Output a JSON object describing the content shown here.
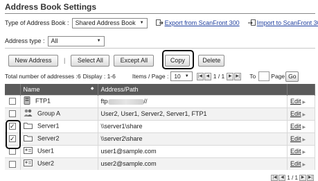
{
  "page": {
    "title": "Address Book Settings"
  },
  "toolbar": {
    "type_label": "Type of Address Book :",
    "type_value": "Shared Address Book",
    "export_link": "Export from ScanFront 300",
    "import_link": "Import to ScanFront 300",
    "address_type_label": "Address type :",
    "address_type_value": "All"
  },
  "actions": {
    "new_address": "New Address",
    "separator": "|",
    "select_all": "Select All",
    "except_all": "Except All",
    "copy": "Copy",
    "delete": "Delete"
  },
  "summary": {
    "total_label": "Total number of addresses :6",
    "display_label": "Display : 1-6",
    "items_label": "Items / Page :",
    "items_value": "10",
    "page_indicator": "1 / 1",
    "to_label": "To",
    "page_label": "Page",
    "go_label": "Go"
  },
  "table": {
    "headers": {
      "name": "Name",
      "address": "Address/Path"
    },
    "edit_label": "Edit",
    "rows": [
      {
        "name": "FTP1",
        "address_prefix": "ftp",
        "address_suffix": "//",
        "checked": false,
        "icon": "ftp-server-icon"
      },
      {
        "name": "Group A",
        "address": "User2, User1, Server2, Server1, FTP1",
        "checked": false,
        "icon": "group-icon"
      },
      {
        "name": "Server1",
        "address": "\\\\server1\\share",
        "checked": true,
        "icon": "folder-icon"
      },
      {
        "name": "Server2",
        "address": "\\\\server2\\share",
        "checked": true,
        "icon": "folder-icon"
      },
      {
        "name": "User1",
        "address": "user1@sample.com",
        "checked": false,
        "icon": "user-card-icon"
      },
      {
        "name": "User2",
        "address": "user2@sample.com",
        "checked": false,
        "icon": "user-card-icon"
      }
    ]
  },
  "footer": {
    "page_indicator": "1 / 1"
  }
}
